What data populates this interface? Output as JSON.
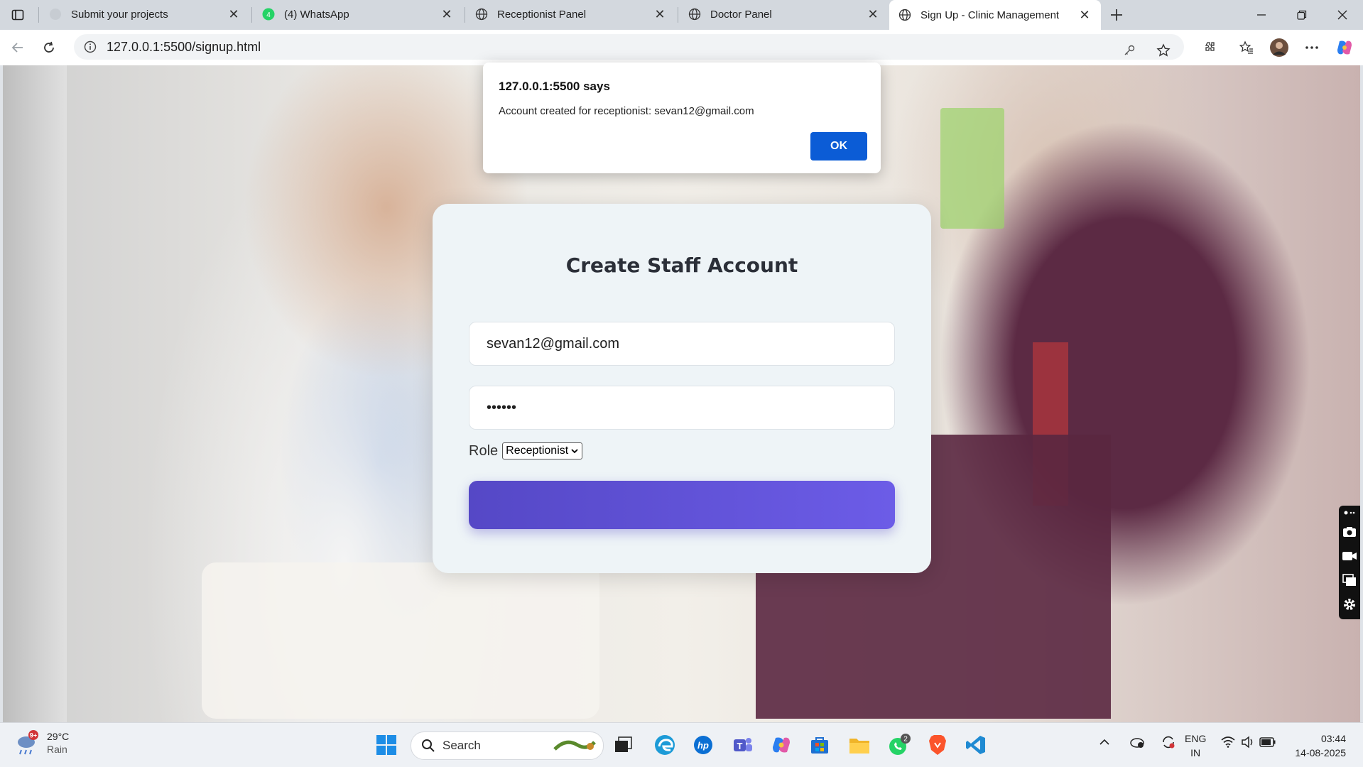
{
  "browser": {
    "tabs": [
      {
        "title": "Submit your projects",
        "favicon": "blank-page-icon"
      },
      {
        "title": "(4) WhatsApp",
        "favicon": "whatsapp-icon"
      },
      {
        "title": "Receptionist Panel",
        "favicon": "globe-icon"
      },
      {
        "title": "Doctor Panel",
        "favicon": "globe-icon"
      },
      {
        "title": "Sign Up - Clinic Management",
        "favicon": "globe-icon",
        "active": true
      }
    ],
    "url": "127.0.0.1:5500/signup.html"
  },
  "dialog": {
    "title": "127.0.0.1:5500 says",
    "message": "Account created for receptionist: sevan12@gmail.com",
    "ok_label": "OK"
  },
  "form": {
    "heading": "Create Staff Account",
    "email_value": "sevan12@gmail.com",
    "password_value": "••••••",
    "role_label": "Role",
    "role_selected": "Receptionist"
  },
  "taskbar": {
    "weather_temp": "29°C",
    "weather_desc": "Rain",
    "weather_badge": "9+",
    "search_placeholder": "Search",
    "whatsapp_badge": "2",
    "lang_top": "ENG",
    "lang_bottom": "IN",
    "time": "03:44",
    "date": "14-08-2025"
  },
  "colors": {
    "accent_button": "#6c5ce7",
    "dialog_ok": "#0b5cd6"
  }
}
